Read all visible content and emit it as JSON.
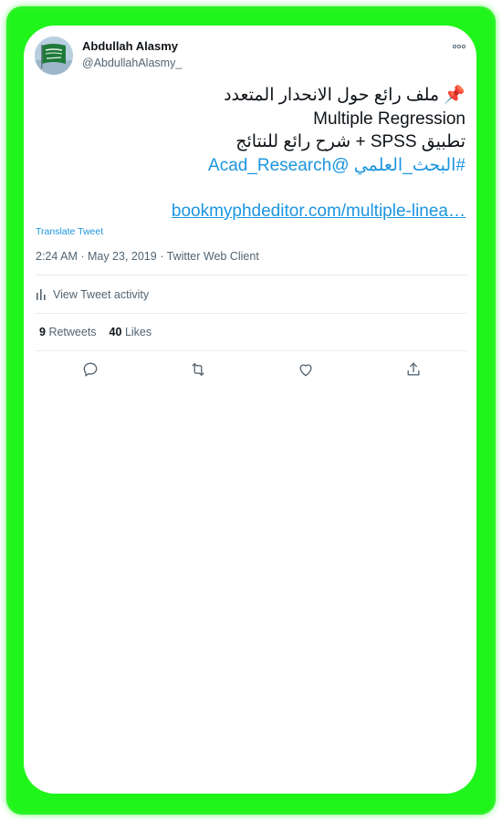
{
  "tweet": {
    "author_name": "Abdullah Alasmy",
    "author_handle": "@AbdullahAlasmy_",
    "avatar_icon": "saudi-flag-avatar",
    "more_icon": "more-dots-icon",
    "line1_emoji": "📌",
    "line1_text": " ملف رائع حول الانحدار المتعدد",
    "line2": "Multiple Regression",
    "line3": "تطبيق SPSS + شرح رائع للنتائج",
    "hashtag": "#البحث_العلمي",
    "mention": "@Acad_Research",
    "link": "bookmyphdeditor.com/multiple-linea…",
    "translate": "Translate Tweet",
    "timestamp": "2:24 AM · May 23, 2019 · Twitter Web Client"
  },
  "activity": {
    "label": "View Tweet activity",
    "icon": "bar-chart-icon"
  },
  "stats": {
    "retweets_count": "9",
    "retweets_label": "Retweets",
    "likes_count": "40",
    "likes_label": "Likes"
  },
  "actions": {
    "icons": [
      "reply-icon",
      "retweet-icon",
      "like-icon",
      "share-icon"
    ]
  },
  "colors": {
    "frame": "#1ff51a",
    "link": "#1b95e0",
    "text": "#0f1419",
    "muted": "#536471"
  }
}
